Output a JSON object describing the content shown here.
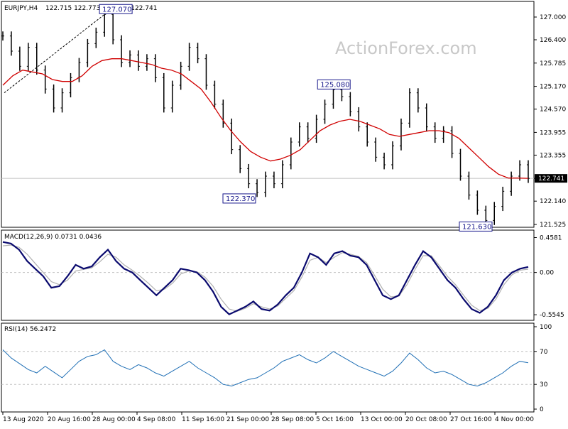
{
  "header": {
    "symbol": "EURJPY,H4",
    "ohlc": "122.715 122.773 122.647 122.741"
  },
  "watermark": "ActionForex.com",
  "colors": {
    "price": "#000000",
    "ma": "#d00000",
    "macd": "#0a0a6e",
    "signal": "#b0b0b0",
    "rsi": "#1f6fb5",
    "grid": "#c0c0c0",
    "callout": "#1a1a8c"
  },
  "chart_data": [
    {
      "type": "line",
      "panel": "price",
      "ylim": [
        121.525,
        127.3
      ],
      "y_ticks": [
        "127.000",
        "126.400",
        "125.785",
        "125.170",
        "124.570",
        "123.955",
        "123.355",
        "122.741",
        "122.140",
        "121.525"
      ],
      "current_value": "122.741",
      "annotations": [
        {
          "label": "127.070",
          "x": 0.215
        },
        {
          "label": "125.080",
          "x": 0.63
        },
        {
          "label": "122.370",
          "x": 0.45
        },
        {
          "label": "121.630",
          "x": 0.9
        }
      ],
      "series": [
        {
          "values": [
            126.5,
            126.1,
            125.7,
            126.2,
            125.6,
            125.1,
            124.6,
            125.0,
            125.4,
            125.8,
            126.3,
            126.6,
            127.07,
            126.4,
            125.8,
            126.0,
            125.7,
            125.9,
            125.4,
            124.6,
            125.2,
            125.7,
            126.2,
            125.9,
            125.2,
            124.7,
            124.2,
            123.5,
            123.0,
            122.6,
            122.37,
            122.8,
            122.6,
            123.1,
            123.7,
            124.1,
            123.8,
            124.3,
            124.7,
            125.08,
            124.9,
            124.5,
            124.1,
            123.7,
            123.3,
            123.1,
            123.6,
            124.2,
            125.0,
            124.6,
            124.1,
            123.8,
            124.0,
            123.4,
            122.8,
            122.3,
            121.9,
            121.63,
            122.0,
            122.4,
            122.8,
            123.1,
            122.741
          ]
        },
        {
          "values": [
            125.2,
            125.45,
            125.6,
            125.55,
            125.5,
            125.35,
            125.3,
            125.3,
            125.45,
            125.7,
            125.85,
            125.9,
            125.9,
            125.85,
            125.8,
            125.75,
            125.65,
            125.6,
            125.5,
            125.3,
            125.1,
            124.75,
            124.35,
            124.0,
            123.7,
            123.45,
            123.3,
            123.2,
            123.25,
            123.35,
            123.5,
            123.75,
            124.0,
            124.15,
            124.25,
            124.3,
            124.25,
            124.15,
            124.05,
            123.9,
            123.85,
            123.9,
            123.95,
            124.0,
            124.0,
            123.95,
            123.8,
            123.55,
            123.3,
            123.05,
            122.85,
            122.75,
            122.75,
            122.741
          ]
        }
      ]
    },
    {
      "type": "line",
      "panel": "macd",
      "title": "MACD(12,26,9) 0.0731 0.0436",
      "ylim": [
        -0.6,
        0.5
      ],
      "y_ticks": [
        "0.4581",
        "0.00",
        "-0.5545"
      ],
      "series": [
        {
          "values": [
            0.4,
            0.38,
            0.3,
            0.15,
            0.05,
            -0.05,
            -0.2,
            -0.18,
            -0.05,
            0.1,
            0.05,
            0.08,
            0.2,
            0.3,
            0.15,
            0.05,
            0.0,
            -0.1,
            -0.2,
            -0.3,
            -0.2,
            -0.1,
            0.05,
            0.03,
            0.0,
            -0.1,
            -0.25,
            -0.45,
            -0.55,
            -0.5,
            -0.45,
            -0.38,
            -0.48,
            -0.5,
            -0.42,
            -0.3,
            -0.2,
            0.0,
            0.25,
            0.2,
            0.1,
            0.25,
            0.28,
            0.22,
            0.2,
            0.1,
            -0.1,
            -0.3,
            -0.35,
            -0.3,
            -0.1,
            0.1,
            0.28,
            0.2,
            0.05,
            -0.1,
            -0.2,
            -0.35,
            -0.48,
            -0.53,
            -0.45,
            -0.3,
            -0.1,
            0.0,
            0.05,
            0.0731
          ]
        },
        {
          "values": [
            0.35,
            0.36,
            0.33,
            0.24,
            0.12,
            0.0,
            -0.12,
            -0.16,
            -0.1,
            0.02,
            0.04,
            0.06,
            0.14,
            0.24,
            0.2,
            0.1,
            0.03,
            -0.05,
            -0.14,
            -0.24,
            -0.22,
            -0.14,
            -0.02,
            0.02,
            0.01,
            -0.06,
            -0.18,
            -0.35,
            -0.48,
            -0.51,
            -0.47,
            -0.41,
            -0.45,
            -0.48,
            -0.44,
            -0.34,
            -0.24,
            -0.06,
            0.16,
            0.2,
            0.13,
            0.2,
            0.26,
            0.24,
            0.21,
            0.13,
            -0.04,
            -0.22,
            -0.32,
            -0.31,
            -0.16,
            0.04,
            0.22,
            0.22,
            0.09,
            -0.05,
            -0.16,
            -0.3,
            -0.43,
            -0.5,
            -0.47,
            -0.35,
            -0.16,
            -0.03,
            0.03,
            0.0436
          ]
        }
      ]
    },
    {
      "type": "line",
      "panel": "rsi",
      "title": "RSI(14) 56.2472",
      "ylim": [
        0,
        100
      ],
      "y_ticks": [
        "100",
        "70",
        "30",
        "0"
      ],
      "levels": [
        70,
        30
      ],
      "series": [
        {
          "values": [
            72,
            62,
            55,
            48,
            44,
            52,
            45,
            38,
            48,
            58,
            64,
            66,
            72,
            58,
            52,
            48,
            54,
            50,
            44,
            40,
            46,
            52,
            58,
            50,
            44,
            38,
            30,
            28,
            32,
            36,
            38,
            44,
            50,
            58,
            62,
            66,
            60,
            56,
            62,
            70,
            64,
            58,
            52,
            48,
            44,
            40,
            46,
            56,
            68,
            60,
            50,
            44,
            46,
            42,
            36,
            30,
            28,
            32,
            38,
            44,
            52,
            58,
            56.2
          ]
        }
      ]
    },
    {
      "type": "table",
      "panel": "time-axis",
      "x_labels": [
        "13 Aug 2020",
        "20 Aug 16:00",
        "28 Aug 00:00",
        "4 Sep 08:00",
        "11 Sep 16:00",
        "21 Sep 00:00",
        "28 Sep 08:00",
        "5 Oct 16:00",
        "13 Oct 00:00",
        "20 Oct 08:00",
        "27 Oct 16:00",
        "4 Nov 00:00"
      ]
    }
  ]
}
